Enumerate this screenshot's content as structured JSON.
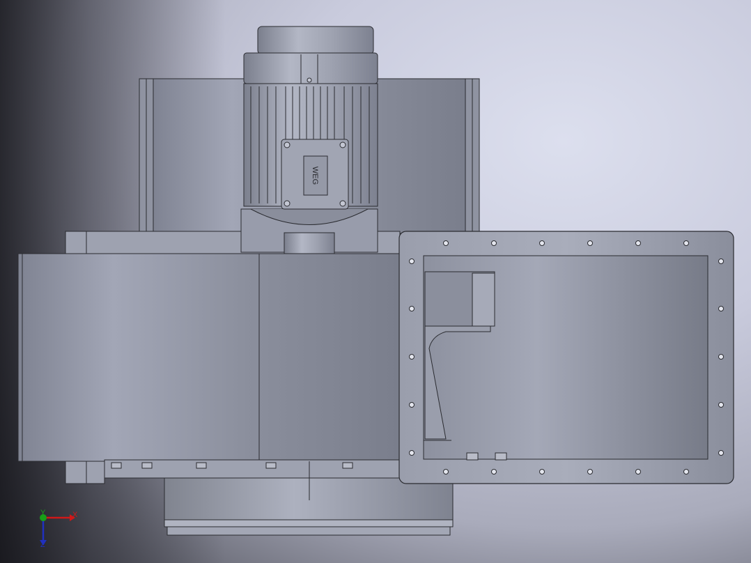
{
  "viewport": {
    "background_top": "#dcdfee",
    "background_dark": "#3c3d45",
    "model_fill": "#8e92a0",
    "model_light": "#a7abba",
    "edge_color": "#2a2b30"
  },
  "model": {
    "motor_logo_text": "WEG"
  },
  "triad": {
    "x_label": "X",
    "y_label": "Y",
    "z_label": "Z",
    "x_color": "#d01818",
    "y_color": "#18a018",
    "z_color": "#2030c0"
  }
}
